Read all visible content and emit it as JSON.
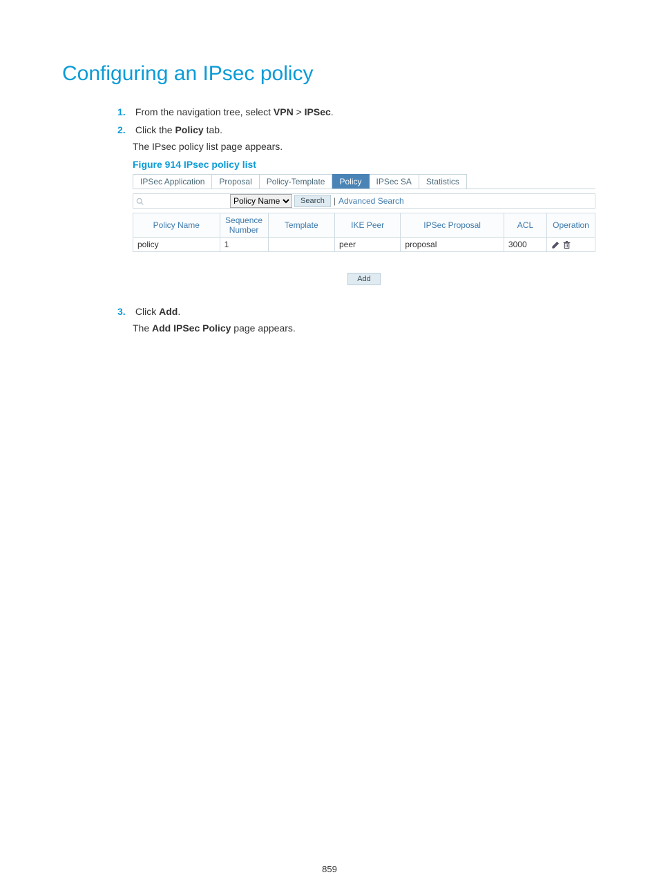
{
  "heading": "Configuring an IPsec policy",
  "steps": [
    {
      "num": "1.",
      "text_pre": "From the navigation tree, select ",
      "bold1": "VPN",
      "gt": " > ",
      "bold2": "IPSec",
      "text_post": "."
    },
    {
      "num": "2.",
      "text_pre": "Click the ",
      "bold1": "Policy",
      "text_post": " tab.",
      "sub": "The IPsec policy list page appears.",
      "figure": "Figure 914 IPsec policy list"
    },
    {
      "num": "3.",
      "text_pre": "Click ",
      "bold1": "Add",
      "text_post": ".",
      "sub_pre": "The ",
      "sub_bold": "Add IPSec Policy",
      "sub_post": " page appears."
    }
  ],
  "ui": {
    "tabs": [
      "IPSec Application",
      "Proposal",
      "Policy-Template",
      "Policy",
      "IPSec SA",
      "Statistics"
    ],
    "active_tab_index": 3,
    "search": {
      "placeholder": "",
      "select_value": "Policy Name",
      "search_btn": "Search",
      "advanced": "Advanced Search"
    },
    "table": {
      "headers": [
        "Policy Name",
        "Sequence Number",
        "Template",
        "IKE Peer",
        "IPSec Proposal",
        "ACL",
        "Operation"
      ],
      "rows": [
        {
          "policy_name": "policy",
          "seq": "1",
          "template": "",
          "ike": "peer",
          "proposal": "proposal",
          "acl": "3000"
        }
      ]
    },
    "add_btn": "Add"
  },
  "page_number": "859"
}
